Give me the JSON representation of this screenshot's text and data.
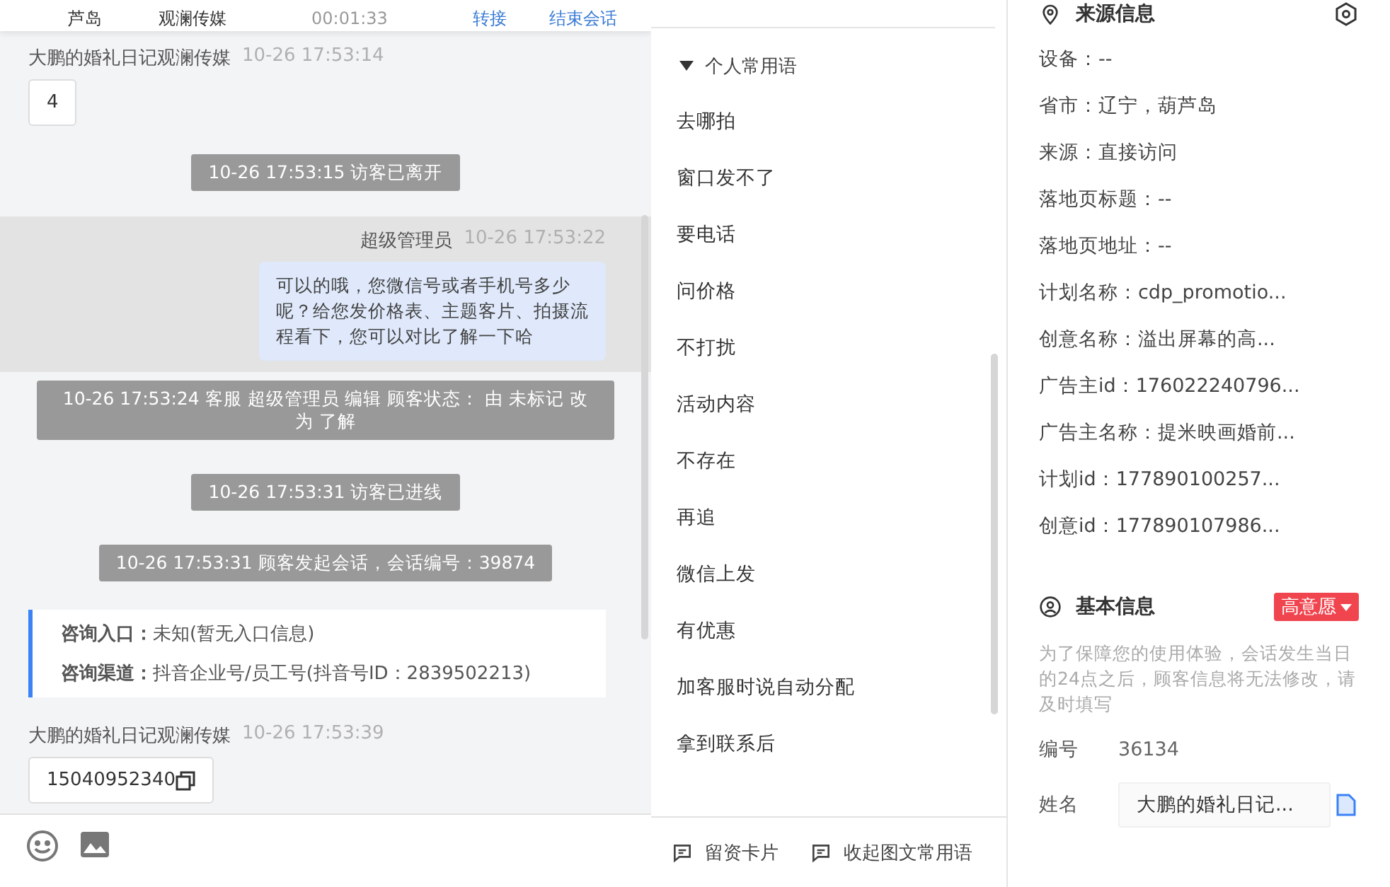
{
  "header": {
    "location": "芦岛",
    "name": "观澜传媒",
    "duration": "00:01:33",
    "actions": [
      "转接",
      "结束会话"
    ]
  },
  "chat": {
    "messages": [
      {
        "kind": "visitor",
        "sender": "大鹏的婚礼日记观澜传媒",
        "time": "10-26 17:53:14",
        "text": "4",
        "copy": false
      },
      {
        "kind": "system",
        "text": "10-26 17:53:15 访客已离开"
      },
      {
        "kind": "agent",
        "sender": "超级管理员",
        "time": "10-26 17:53:22",
        "text": "可以的哦，您微信号或者手机号多少呢？给您发价格表、主题客片、拍摄流程看下，您可以对比了解一下哈",
        "highlighted": true
      },
      {
        "kind": "system",
        "text": "10-26 17:53:24 客服 超级管理员 编辑 顾客状态： 由 未标记 改为 了解"
      },
      {
        "kind": "system",
        "text": "10-26 17:53:31 访客已进线"
      },
      {
        "kind": "system",
        "text": "10-26 17:53:31 顾客发起会话，会话编号：39874"
      },
      {
        "kind": "info",
        "rows": [
          {
            "label": "咨询入口：",
            "value": "未知(暂无入口信息)"
          },
          {
            "label": "咨询渠道：",
            "value": "抖音企业号/员工号(抖音号ID：2839502213)"
          }
        ]
      },
      {
        "kind": "visitor",
        "sender": "大鹏的婚礼日记观澜传媒",
        "time": "10-26 17:53:39",
        "text": "15040952340",
        "copy": true
      }
    ]
  },
  "phrases": {
    "group": "个人常用语",
    "expanded": true,
    "items": [
      "去哪拍",
      "窗口发不了",
      "要电话",
      "问价格",
      "不打扰",
      "活动内容",
      "不存在",
      "再追",
      "微信上发",
      "有优惠",
      "加客服时说自动分配",
      "拿到联系后"
    ],
    "footer": [
      "留资卡片",
      "收起图文常用语"
    ]
  },
  "source_info": {
    "title": "来源信息",
    "rows": [
      "设备：--",
      "省市：辽宁，葫芦岛",
      "来源：直接访问",
      "落地页标题：--",
      "落地页地址：--",
      "计划名称：cdp_promotio...",
      "创意名称：溢出屏幕的高...",
      "广告主id：176022240796...",
      "广告主名称：提米映画婚前...",
      "计划id：177890100257...",
      "创意id：177890107986..."
    ]
  },
  "basic_info": {
    "title": "基本信息",
    "tag": "高意愿",
    "notice": "为了保障您的使用体验，会话发生当日的24点之后，顾客信息将无法修改，请及时填写",
    "fields": [
      {
        "kind": "text",
        "label": "编号",
        "value": "36134"
      },
      {
        "kind": "input",
        "label": "姓名",
        "value": "大鹏的婚礼日记..."
      }
    ]
  }
}
